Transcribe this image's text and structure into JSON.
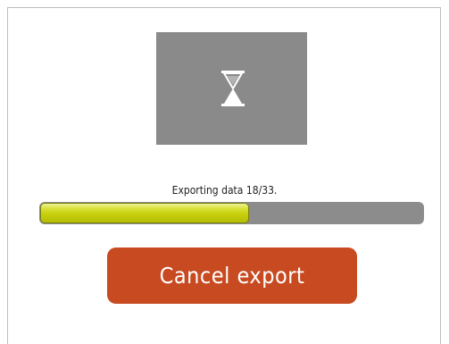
{
  "dialog": {
    "icon": "hourglass-icon",
    "status_text": "Exporting data 18/33.",
    "progress": {
      "current": 18,
      "total": 33,
      "fraction": 0.545
    },
    "cancel_label": "Cancel export"
  },
  "colors": {
    "panel": "#8a8a8a",
    "progress_track": "#8c8c8c",
    "progress_fill": "#c7cf0c",
    "button": "#c74a21",
    "button_text": "#ffffff"
  }
}
